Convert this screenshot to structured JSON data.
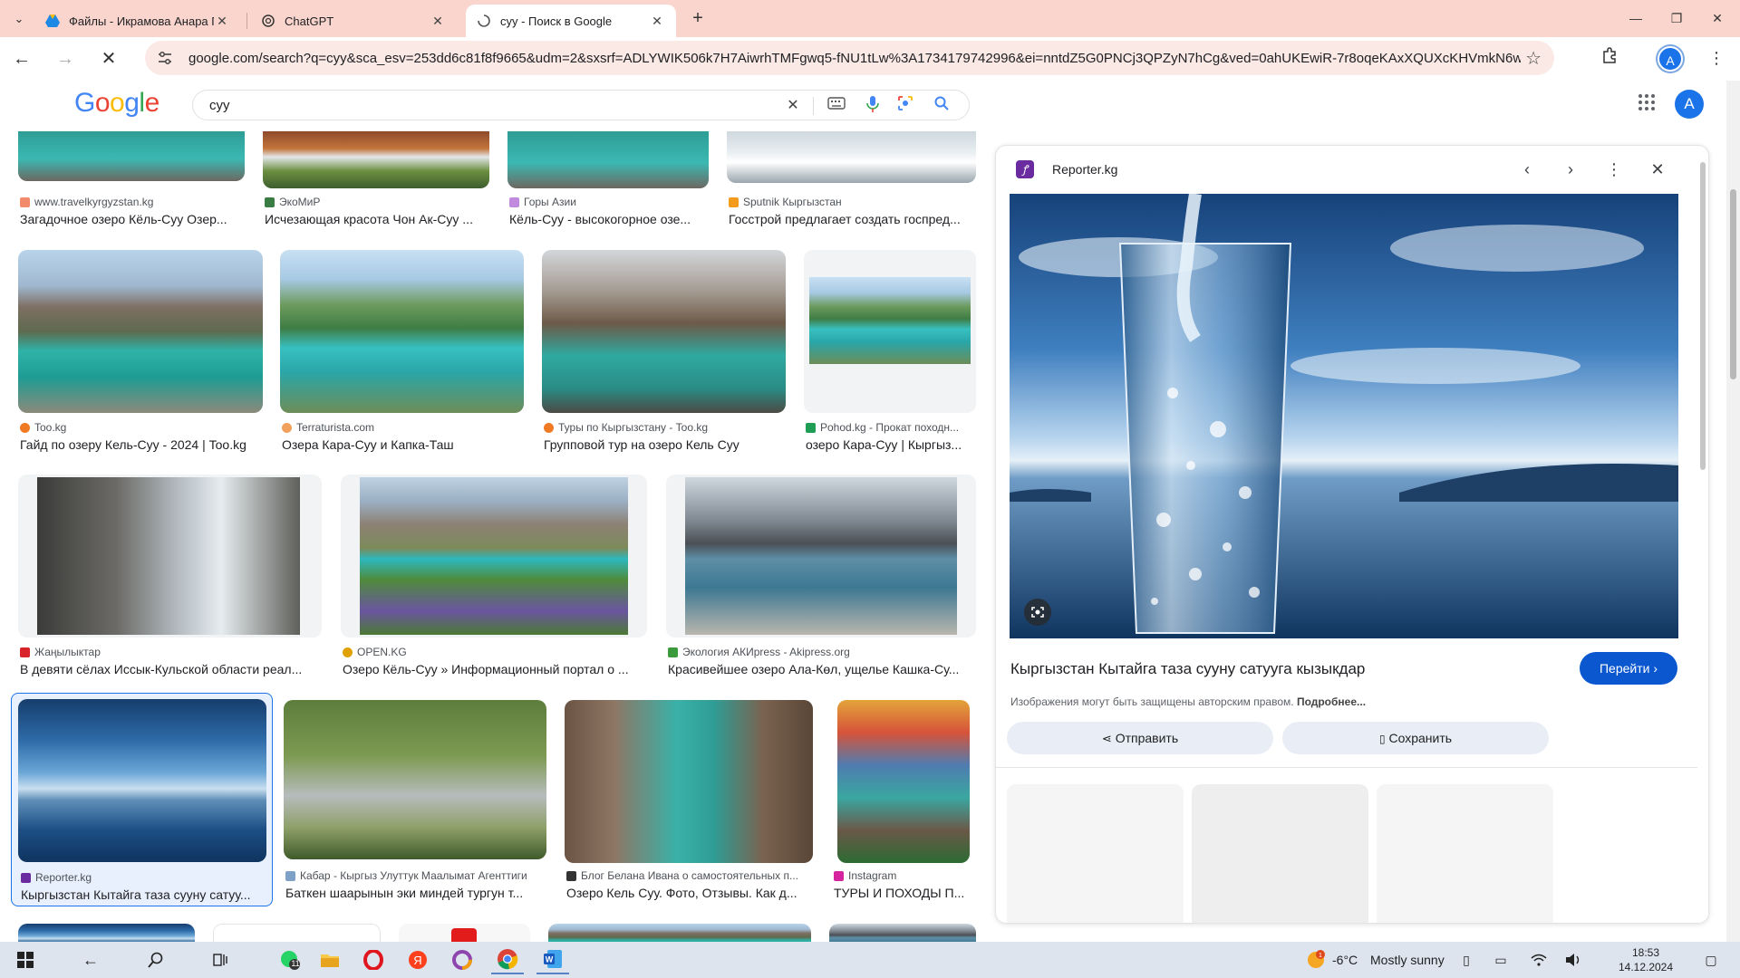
{
  "browser": {
    "tabs": [
      {
        "title": "Файлы - Икрамова Анара П",
        "favicon": "drive-icon"
      },
      {
        "title": "ChatGPT",
        "favicon": "chatgpt-icon"
      },
      {
        "title": "суу - Поиск в Google",
        "favicon": "loading-icon",
        "active": true
      }
    ],
    "url": "google.com/search?q=суу&sca_esv=253dd6c81f8f9665&udm=2&sxsrf=ADLYWIK506k7H7AiwrhTMFgwq5-fNU1tLw%3A1734179742996&ei=nntdZ5G0PNCj3QPZyN7hCg&ved=0ahUKEwiR-7r8oqeKAxXQUXcKHVmkN6wQ4...",
    "profile_initial": "A"
  },
  "search": {
    "query": "суу",
    "avatar_initial": "A"
  },
  "results": {
    "row0": [
      {
        "source": "www.travelkyrgyzstan.kg",
        "title": "Загадочное озеро Кёль-Суу Озер..."
      },
      {
        "source": "ЭкоМиР",
        "title": "Исчезающая красота Чон Ак-Суу ..."
      },
      {
        "source": "Горы Азии",
        "title": "Кёль-Суу - высокогорное озе..."
      },
      {
        "source": "Sputnik Кыргызстан",
        "title": "Госстрой предлагает создать госпред..."
      }
    ],
    "row1": [
      {
        "source": "Too.kg",
        "title": "Гайд по озеру Кель-Суу - 2024 | Too.kg"
      },
      {
        "source": "Terraturista.com",
        "title": "Озера Кара-Суу и Капка-Таш"
      },
      {
        "source": "Туры по Кыргызстану - Too.kg",
        "title": "Групповой тур на озеро Кель Суу"
      },
      {
        "source": "Pohod.kg - Прокат походн...",
        "title": "озеро Кара-Суу | Кыргыз..."
      }
    ],
    "row2": [
      {
        "source": "Жаңылыктар",
        "title": "В девяти сёлах Иссык-Кульской области реал..."
      },
      {
        "source": "OPEN.KG",
        "title": "Озеро Кёль-Суу » Информационный портал о ..."
      },
      {
        "source": "Экология АКИpress - Akipress.org",
        "title": "Красивейшее озеро Ала-Көл, ущелье Кашка-Су..."
      }
    ],
    "row3": [
      {
        "source": "Reporter.kg",
        "title": "Кыргызстан Кытайга таза сууну сатуу..."
      },
      {
        "source": "Кабар - Кыргыз Улуттук Маалымат Агенттиги",
        "title": "Баткен шаарынын эки миндей тургун т..."
      },
      {
        "source": "Блог Белана Ивана о самостоятельных п...",
        "title": "Озеро Кель Суу. Фото, Отзывы. Как д..."
      },
      {
        "source": "Instagram",
        "title": "ТУРЫ И ПОХОДЫ П..."
      }
    ]
  },
  "panel": {
    "site": "Reporter.kg",
    "title": "Кыргызстан Кытайга таза сууну сатууга кызыкдар",
    "visit_label": "Перейти",
    "copyright": "Изображения могут быть защищены авторским правом.",
    "more_label": "Подробнее...",
    "share_label": "Отправить",
    "save_label": "Сохранить"
  },
  "taskbar": {
    "notification_count": "11",
    "temperature": "-6°C",
    "weather": "Mostly sunny",
    "time": "18:53",
    "date": "14.12.2024"
  },
  "colors": {
    "accent": "#1a73e8",
    "tabbar": "#fad5cd",
    "visit_button": "#0b57d0"
  }
}
